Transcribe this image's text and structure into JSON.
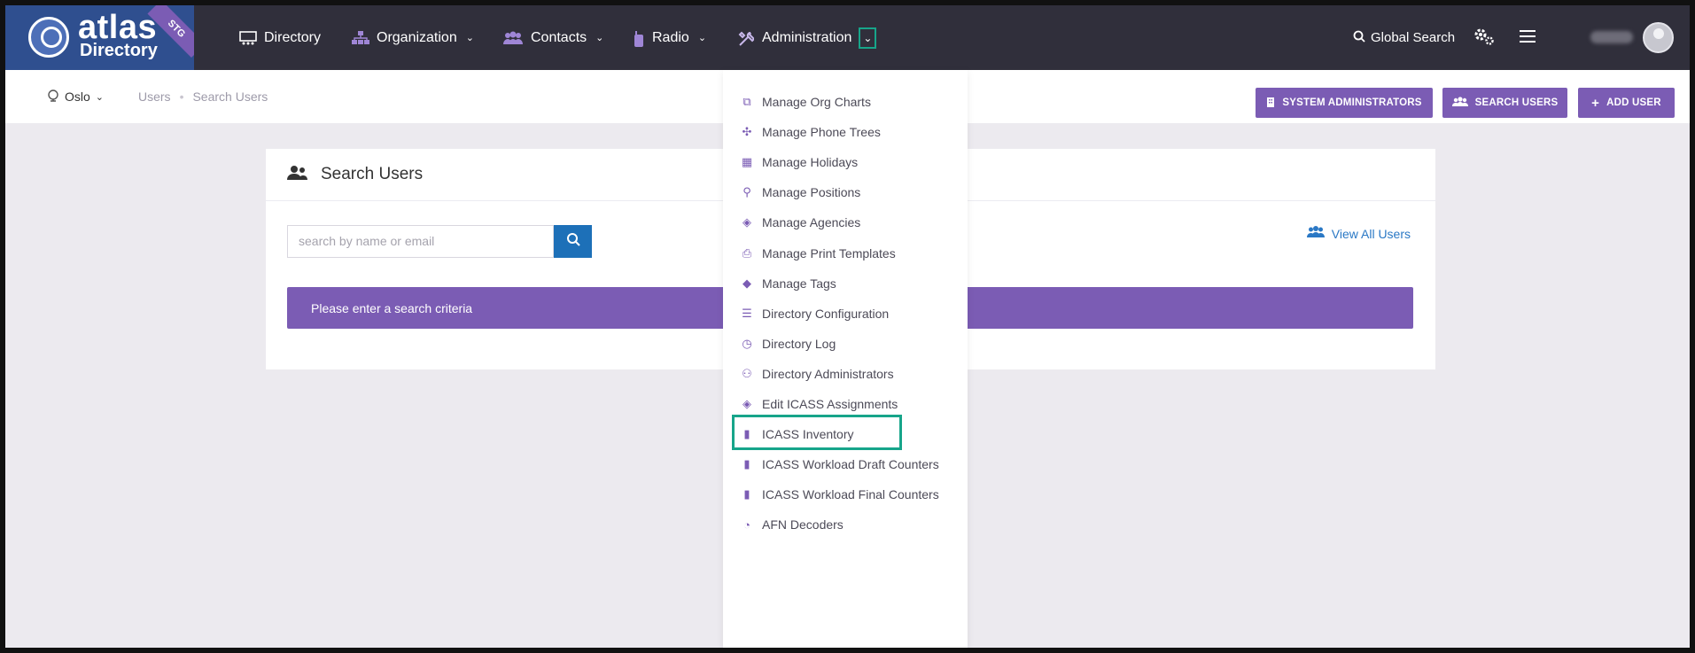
{
  "app": {
    "logo_text": "atlas",
    "logo_subtext": "Directory",
    "env_badge": "STG"
  },
  "nav": {
    "directory": "Directory",
    "organization": "Organization",
    "contacts": "Contacts",
    "radio": "Radio",
    "administration": "Administration",
    "global_search": "Global Search"
  },
  "subbar": {
    "location": "Oslo",
    "breadcrumb_users": "Users",
    "breadcrumb_current": "Search Users",
    "btn_system_admins": "SYSTEM ADMINISTRATORS",
    "btn_search_users": "SEARCH USERS",
    "btn_add_user": "ADD USER"
  },
  "card": {
    "title": "Search Users",
    "search_placeholder": "search by name or email",
    "view_all": "View All Users",
    "alert": "Please enter a search criteria"
  },
  "admin_menu": [
    {
      "label": "Manage Org Charts",
      "icon": "sitemap-icon"
    },
    {
      "label": "Manage Phone Trees",
      "icon": "network-icon"
    },
    {
      "label": "Manage Holidays",
      "icon": "calendar-icon"
    },
    {
      "label": "Manage Positions",
      "icon": "person-position-icon"
    },
    {
      "label": "Manage Agencies",
      "icon": "layers-icon"
    },
    {
      "label": "Manage Print Templates",
      "icon": "printer-icon"
    },
    {
      "label": "Manage Tags",
      "icon": "tags-icon"
    },
    {
      "label": "Directory Configuration",
      "icon": "sliders-icon"
    },
    {
      "label": "Directory Log",
      "icon": "clock-icon"
    },
    {
      "label": "Directory Administrators",
      "icon": "user-shield-icon"
    },
    {
      "label": "Edit ICASS Assignments",
      "icon": "layers-icon"
    },
    {
      "label": "ICASS Inventory",
      "icon": "file-icon"
    },
    {
      "label": "ICASS Workload Draft Counters",
      "icon": "file-icon"
    },
    {
      "label": "ICASS Workload Final Counters",
      "icon": "file-icon"
    },
    {
      "label": "AFN Decoders",
      "icon": "satellite-dish-icon"
    }
  ],
  "colors": {
    "nav_bg": "#302f3b",
    "accent": "#7b5cb4",
    "highlight": "#17a58a",
    "search_btn": "#1d70b8"
  }
}
